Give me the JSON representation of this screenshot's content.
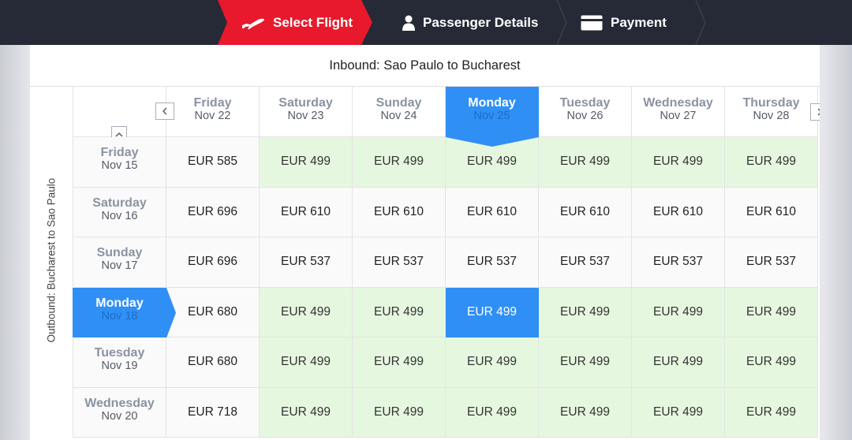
{
  "steps": [
    {
      "label": "Select Flight",
      "icon": "airplane-icon",
      "active": true
    },
    {
      "label": "Passenger Details",
      "icon": "person-icon",
      "active": false
    },
    {
      "label": "Payment",
      "icon": "credit-card-icon",
      "active": false
    }
  ],
  "colors": {
    "topbar": "#252a36",
    "active_step": "#e8192c",
    "selected": "#2f8ff5",
    "cheapest_bg": "#e6f7df",
    "default_bg": "#fafafa"
  },
  "inbound_title": "Inbound: Sao Paulo to Bucharest",
  "outbound_title": "Outbound: Bucharest to Sao Paulo",
  "columns": [
    {
      "day": "Friday",
      "date": "Nov 22"
    },
    {
      "day": "Saturday",
      "date": "Nov 23"
    },
    {
      "day": "Sunday",
      "date": "Nov 24"
    },
    {
      "day": "Monday",
      "date": "Nov 25",
      "selected": true
    },
    {
      "day": "Tuesday",
      "date": "Nov 26"
    },
    {
      "day": "Wednesday",
      "date": "Nov 27"
    },
    {
      "day": "Thursday",
      "date": "Nov 28"
    }
  ],
  "rows": [
    {
      "day": "Friday",
      "date": "Nov 15",
      "prices": [
        "EUR 585",
        "EUR 499",
        "EUR 499",
        "EUR 499",
        "EUR 499",
        "EUR 499",
        "EUR 499"
      ],
      "cheapest": [
        false,
        true,
        true,
        true,
        true,
        true,
        true
      ]
    },
    {
      "day": "Saturday",
      "date": "Nov 16",
      "prices": [
        "EUR 696",
        "EUR 610",
        "EUR 610",
        "EUR 610",
        "EUR 610",
        "EUR 610",
        "EUR 610"
      ],
      "cheapest": [
        false,
        false,
        false,
        false,
        false,
        false,
        false
      ]
    },
    {
      "day": "Sunday",
      "date": "Nov 17",
      "prices": [
        "EUR 696",
        "EUR 537",
        "EUR 537",
        "EUR 537",
        "EUR 537",
        "EUR 537",
        "EUR 537"
      ],
      "cheapest": [
        false,
        false,
        false,
        false,
        false,
        false,
        false
      ]
    },
    {
      "day": "Monday",
      "date": "Nov 18",
      "selected": true,
      "prices": [
        "EUR 680",
        "EUR 499",
        "EUR 499",
        "EUR 499",
        "EUR 499",
        "EUR 499",
        "EUR 499"
      ],
      "cheapest": [
        false,
        true,
        true,
        true,
        true,
        true,
        true
      ]
    },
    {
      "day": "Tuesday",
      "date": "Nov 19",
      "prices": [
        "EUR 680",
        "EUR 499",
        "EUR 499",
        "EUR 499",
        "EUR 499",
        "EUR 499",
        "EUR 499"
      ],
      "cheapest": [
        false,
        true,
        true,
        true,
        true,
        true,
        true
      ]
    },
    {
      "day": "Wednesday",
      "date": "Nov 20",
      "prices": [
        "EUR 718",
        "EUR 499",
        "EUR 499",
        "EUR 499",
        "EUR 499",
        "EUR 499",
        "EUR 499"
      ],
      "cheapest": [
        false,
        true,
        true,
        true,
        true,
        true,
        true
      ]
    }
  ],
  "selected_cell": {
    "row": 3,
    "col": 3
  }
}
